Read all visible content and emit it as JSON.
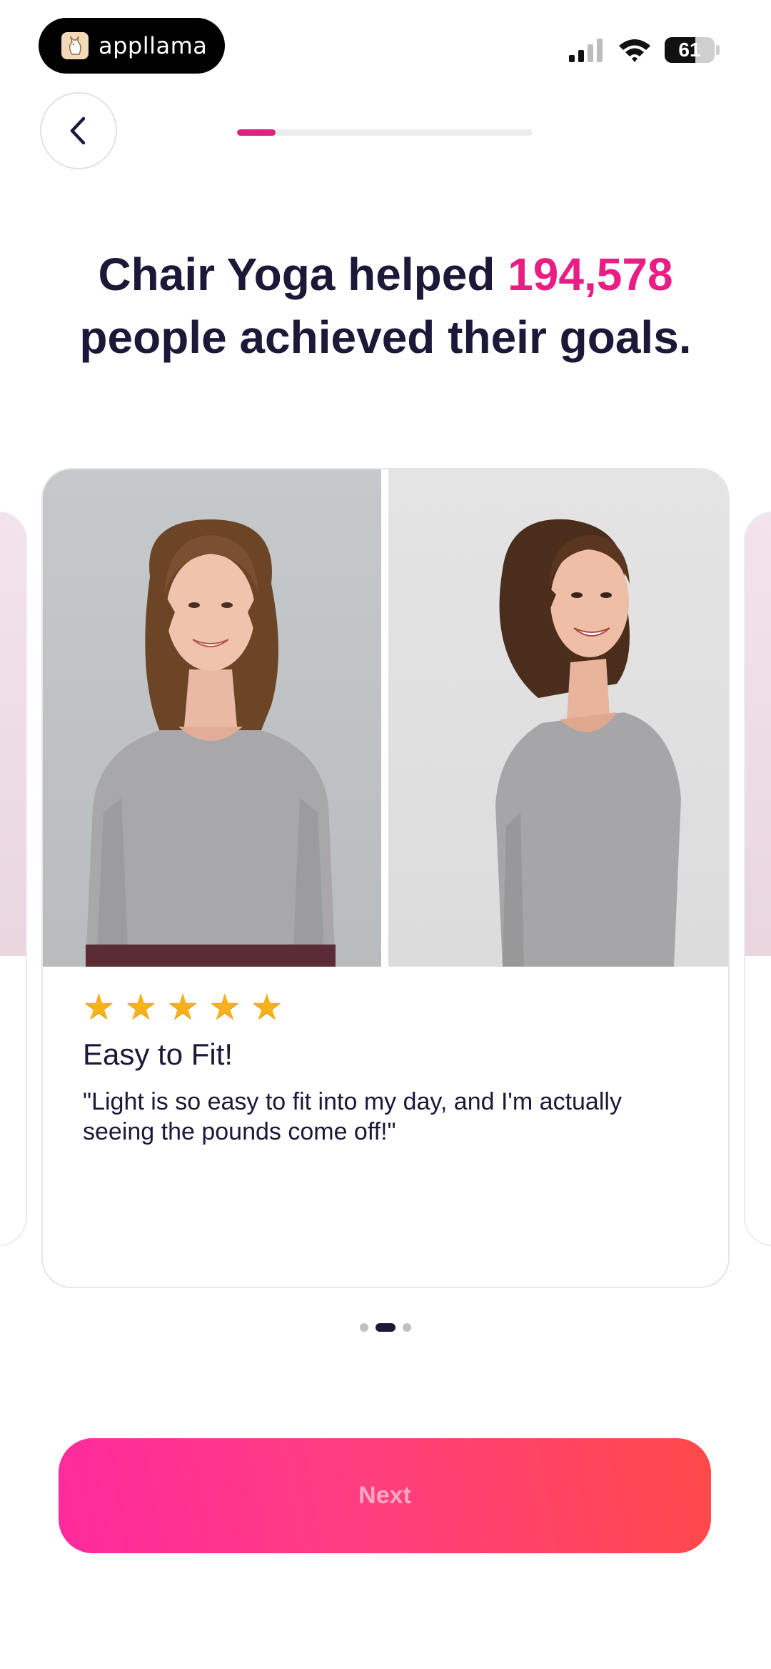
{
  "status_bar": {
    "app_pill_text": "appllama",
    "battery_level": "61",
    "battery_fraction": 0.61
  },
  "header": {
    "progress_fraction": 0.13
  },
  "headline": {
    "before": "Chair Yoga helped ",
    "number": "194,578",
    "after": " people achieved their goals."
  },
  "testimonial": {
    "rating": 5,
    "stars": [
      "★",
      "★",
      "★",
      "★",
      "★"
    ],
    "title": "Easy to Fit!",
    "quote": "\"Light is so easy to fit into my day, and I'm actually seeing the pounds come off!\""
  },
  "carousel": {
    "total": 3,
    "active_index": 1
  },
  "next_button_label": "Next",
  "colors": {
    "accent": "#e91e84",
    "text": "#1b1838",
    "star": "#f7b21b"
  }
}
